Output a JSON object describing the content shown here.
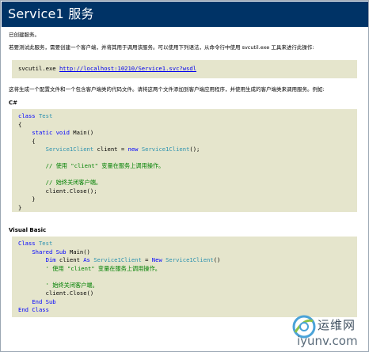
{
  "page": {
    "title": "Service1 服务"
  },
  "intro": {
    "created": "已创建服务。",
    "instructions": "若要测试此服务，需要创建一个客户端，并将其用于调用该服务。可以使用下列语法，从命令行中使用 svcutil.exe 工具来进行此操作:",
    "cmd_prefix": "svcutil.exe ",
    "cmd_link": "http://localhost:10210/Service1.svc?wsdl",
    "generated": "这将生成一个配置文件和一个包含客户端类的代码文件。请将这两个文件添加到客户端应用程序，并使用生成的客户端类来调用服务。例如:"
  },
  "csharp": {
    "heading": "C#",
    "lines": [
      [
        [
          "kw",
          "class"
        ],
        [
          "t",
          " "
        ],
        [
          "ty",
          "Test"
        ]
      ],
      [
        [
          "t",
          "{"
        ]
      ],
      [
        [
          "t",
          "    "
        ],
        [
          "kw",
          "static"
        ],
        [
          "t",
          " "
        ],
        [
          "kw",
          "void"
        ],
        [
          "t",
          " Main()"
        ]
      ],
      [
        [
          "t",
          "    {"
        ]
      ],
      [
        [
          "t",
          "        "
        ],
        [
          "ty",
          "Service1Client"
        ],
        [
          "t",
          " client = "
        ],
        [
          "kw",
          "new"
        ],
        [
          "t",
          " "
        ],
        [
          "ty",
          "Service1Client"
        ],
        [
          "t",
          "();"
        ]
      ],
      [
        [
          "t",
          ""
        ]
      ],
      [
        [
          "t",
          "        "
        ],
        [
          "cm",
          "// 使用 \"client\" 变量在服务上调用操作。"
        ]
      ],
      [
        [
          "t",
          ""
        ]
      ],
      [
        [
          "t",
          "        "
        ],
        [
          "cm",
          "// 始终关闭客户端。"
        ]
      ],
      [
        [
          "t",
          "        client.Close();"
        ]
      ],
      [
        [
          "t",
          "    }"
        ]
      ],
      [
        [
          "t",
          "}"
        ]
      ]
    ]
  },
  "vb": {
    "heading": "Visual Basic",
    "lines": [
      [
        [
          "kw",
          "Class"
        ],
        [
          "t",
          " "
        ],
        [
          "ty",
          "Test"
        ]
      ],
      [
        [
          "t",
          "    "
        ],
        [
          "kw",
          "Shared"
        ],
        [
          "t",
          " "
        ],
        [
          "kw",
          "Sub"
        ],
        [
          "t",
          " Main()"
        ]
      ],
      [
        [
          "t",
          "        "
        ],
        [
          "kw",
          "Dim"
        ],
        [
          "t",
          " client "
        ],
        [
          "kw",
          "As"
        ],
        [
          "t",
          " "
        ],
        [
          "ty",
          "Service1Client"
        ],
        [
          "t",
          " = "
        ],
        [
          "kw",
          "New"
        ],
        [
          "t",
          " "
        ],
        [
          "ty",
          "Service1Client"
        ],
        [
          "t",
          "()"
        ]
      ],
      [
        [
          "t",
          "        "
        ],
        [
          "cm",
          "' 使用 \"client\" 变量在服务上调用操作。"
        ]
      ],
      [
        [
          "t",
          ""
        ]
      ],
      [
        [
          "t",
          "        "
        ],
        [
          "cm",
          "' 始终关闭客户端。"
        ]
      ],
      [
        [
          "t",
          "        client.Close()"
        ]
      ],
      [
        [
          "t",
          "    "
        ],
        [
          "kw",
          "End"
        ],
        [
          "t",
          " "
        ],
        [
          "kw",
          "Sub"
        ]
      ],
      [
        [
          "kw",
          "End"
        ],
        [
          "t",
          " "
        ],
        [
          "kw",
          "Class"
        ]
      ]
    ]
  },
  "watermark": {
    "cn": "运维网",
    "en": "iyunv.com"
  },
  "colors": {
    "header_bg": "#003366",
    "code_bg": "#e5e5cc",
    "keyword": "#0000ff",
    "type": "#2b91af",
    "comment": "#008000"
  },
  "icons": [
    "watermark-logo-icon"
  ]
}
